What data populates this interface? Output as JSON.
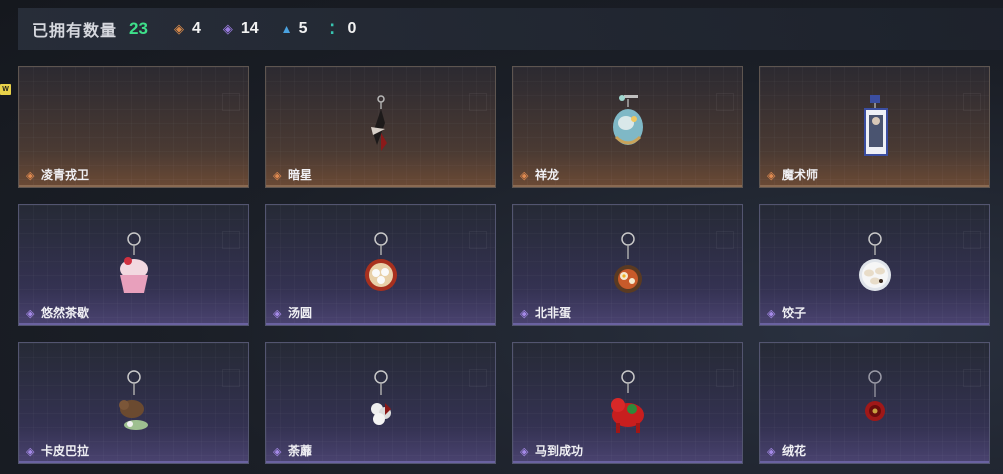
{
  "header": {
    "owned_label": "已拥有数量",
    "owned_count": "23",
    "stats": [
      {
        "icon": "orange-rarity-icon",
        "value": "4",
        "color": "#d98a4a"
      },
      {
        "icon": "purple-rarity-icon",
        "value": "14",
        "color": "#9a7be0"
      },
      {
        "icon": "blue-rarity-icon",
        "value": "5",
        "color": "#4aa2e0"
      },
      {
        "icon": "teal-rarity-icon",
        "value": "0",
        "color": "#38c4b0"
      }
    ]
  },
  "new_badge": "W",
  "cards": [
    {
      "name": "凌青戎卫",
      "rarity": "orange",
      "charm": "empty"
    },
    {
      "name": "暗星",
      "rarity": "orange",
      "charm": "dagger"
    },
    {
      "name": "祥龙",
      "rarity": "orange",
      "charm": "dragon"
    },
    {
      "name": "魔术师",
      "rarity": "orange",
      "charm": "card"
    },
    {
      "name": "悠然茶歇",
      "rarity": "purple",
      "charm": "cupcake"
    },
    {
      "name": "汤圆",
      "rarity": "purple",
      "charm": "tangyuan"
    },
    {
      "name": "北非蛋",
      "rarity": "purple",
      "charm": "shakshuka"
    },
    {
      "name": "饺子",
      "rarity": "purple",
      "charm": "dumplings"
    },
    {
      "name": "卡皮巴拉",
      "rarity": "purple",
      "charm": "capybara"
    },
    {
      "name": "荼蘼",
      "rarity": "purple",
      "charm": "flower-white"
    },
    {
      "name": "马到成功",
      "rarity": "purple",
      "charm": "horse"
    },
    {
      "name": "绒花",
      "rarity": "purple",
      "charm": "flower-red"
    }
  ]
}
